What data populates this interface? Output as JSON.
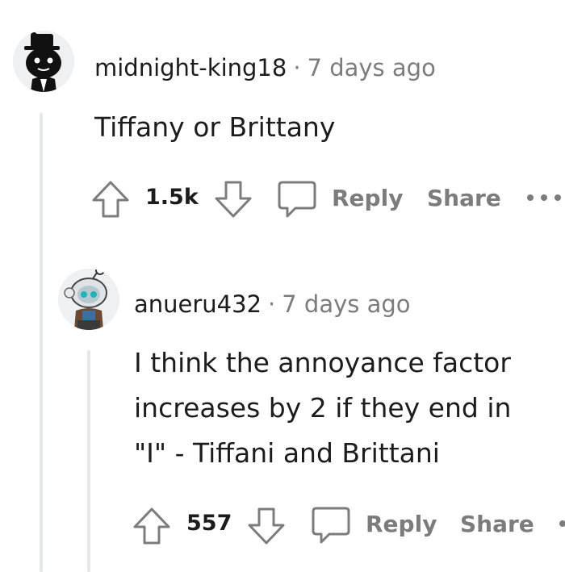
{
  "comments": [
    {
      "author": "midnight-king18",
      "separator": "·",
      "time": "7 days ago",
      "body": "Tiffany or Brittany",
      "score": "1.5k",
      "reply_label": "Reply",
      "share_label": "Share",
      "more_label": "..."
    },
    {
      "author": "anueru432",
      "separator": "·",
      "time": "7 days ago",
      "body_lines": [
        "I think the annoyance factor",
        "increases by 2 if they end in",
        "\"I\" - Tiffani and Brittani"
      ],
      "score": "557",
      "reply_label": "Reply",
      "share_label": "Share"
    }
  ],
  "colors": {
    "text": "#1c1c1c",
    "muted": "#7c7c7c",
    "thread_line": "#e5e7e9"
  },
  "icons": [
    "upvote-icon",
    "downvote-icon",
    "comment-bubble-icon",
    "more-options-icon"
  ]
}
